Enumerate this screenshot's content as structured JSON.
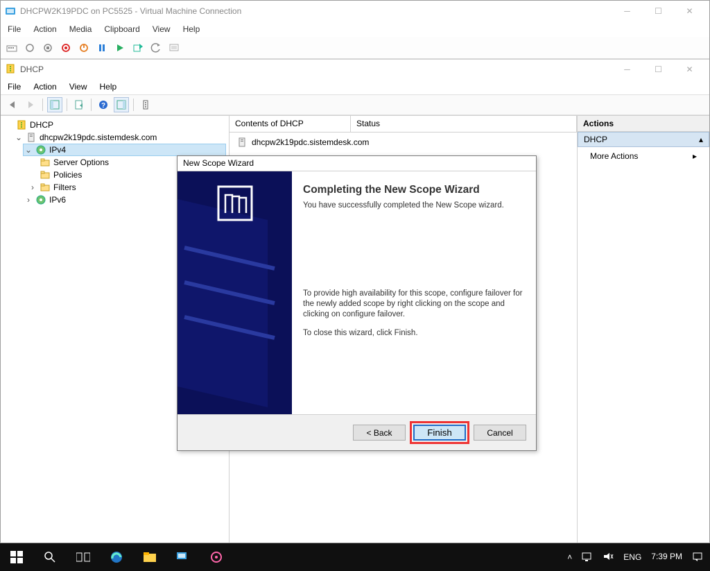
{
  "vm": {
    "title": "DHCPW2K19PDC on PC5525 - Virtual Machine Connection",
    "menu": [
      "File",
      "Action",
      "Media",
      "Clipboard",
      "View",
      "Help"
    ]
  },
  "dhcp": {
    "title": "DHCP",
    "menu": [
      "File",
      "Action",
      "View",
      "Help"
    ],
    "content_cols": {
      "c1": "Contents of DHCP",
      "c2": "Status"
    },
    "content_item": "dhcpw2k19pdc.sistemdesk.com"
  },
  "tree": {
    "root": "DHCP",
    "server": "dhcpw2k19pdc.sistemdesk.com",
    "ipv4": "IPv4",
    "server_options": "Server Options",
    "policies": "Policies",
    "filters": "Filters",
    "ipv6": "IPv6"
  },
  "actions": {
    "title": "Actions",
    "sub": "DHCP",
    "more": "More Actions"
  },
  "wizard": {
    "window_title": "New Scope Wizard",
    "heading": "Completing the New Scope Wizard",
    "line1": "You have successfully completed the New Scope wizard.",
    "line2": "To provide high availability for this scope, configure failover for the newly added scope by right clicking on the scope and clicking on configure failover.",
    "line3": "To close this wizard, click Finish.",
    "back": "< Back",
    "finish": "Finish",
    "cancel": "Cancel"
  },
  "taskbar": {
    "lang": "ENG",
    "time": "7:39 PM"
  }
}
